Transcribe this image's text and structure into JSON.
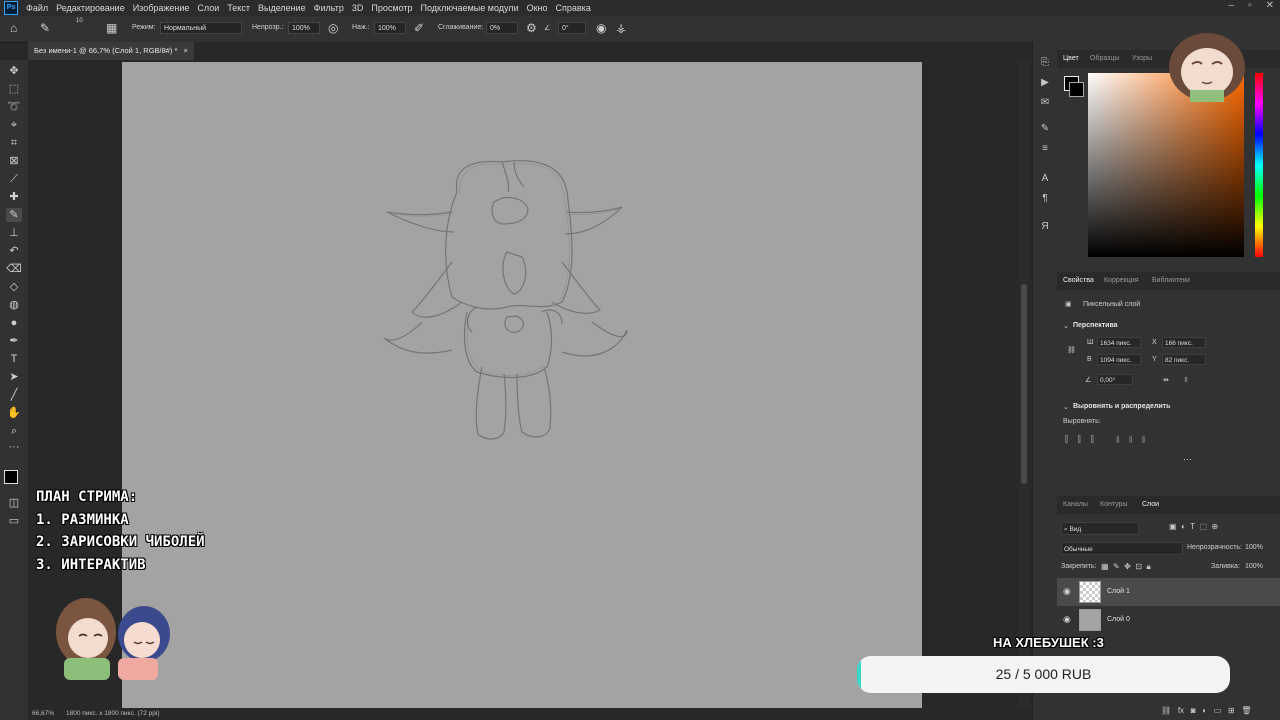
{
  "menubar": {
    "logo": "Ps",
    "items": [
      "Файл",
      "Редактирование",
      "Изображение",
      "Слои",
      "Текст",
      "Выделение",
      "Фильтр",
      "3D",
      "Просмотр",
      "Подключаемые модули",
      "Окно",
      "Справка"
    ]
  },
  "options": {
    "mode_label": "Режим:",
    "mode_value": "Нормальный",
    "opacity_label": "Непрозр.:",
    "opacity_value": "100%",
    "pressure_label": "Наж.:",
    "pressure_value": "100%",
    "smoothing_label": "Сглаживание:",
    "smoothing_value": "0%",
    "angle_value": "0°",
    "brush_size": "10"
  },
  "document": {
    "tab_title": "Без имени-1 @ 66,7% (Слой 1, RGB/8#) *",
    "zoom": "66,67%",
    "info": "1800 пикс. x 1800 пикс. (72 ppi)"
  },
  "color_panel": {
    "tabs": [
      "Цвет",
      "Образцы",
      "Узоры"
    ]
  },
  "properties": {
    "tabs": [
      "Свойства",
      "Коррекция",
      "Библиотеки"
    ],
    "layer_type": "Пиксельный слой",
    "transform_title": "Перспектива",
    "w_label": "Ш",
    "w_value": "1634 пикс.",
    "h_label": "В",
    "h_value": "1094 пикс.",
    "x_label": "X",
    "x_value": "166 пикс.",
    "y_label": "Y",
    "y_value": "82 пикс.",
    "angle": "0,00°",
    "align_title": "Выровнять и распределить",
    "align_label": "Выровнять:"
  },
  "layers": {
    "tabs": [
      "Каналы",
      "Контуры",
      "Слои"
    ],
    "filter": "Вид",
    "blend": "Обычные",
    "opacity_label": "Непрозрачность:",
    "opacity_value": "100%",
    "lock_label": "Закрепить:",
    "fill_label": "Заливка:",
    "fill_value": "100%",
    "items": [
      {
        "name": "Слой 1"
      },
      {
        "name": "Слой 0"
      }
    ]
  },
  "overlay": {
    "plan_title": "ПЛАН СТРИМА:",
    "plan_items": [
      "1. РАЗМИНКА",
      "2. ЗАРИСОВКИ ЧИБОЛЕЙ",
      "3. ИНТЕРАКТИВ"
    ],
    "donate_title": "НА ХЛЕБУШЕК :3",
    "donate_text": "25 / 5 000 RUB",
    "donate_progress": 0.005
  }
}
